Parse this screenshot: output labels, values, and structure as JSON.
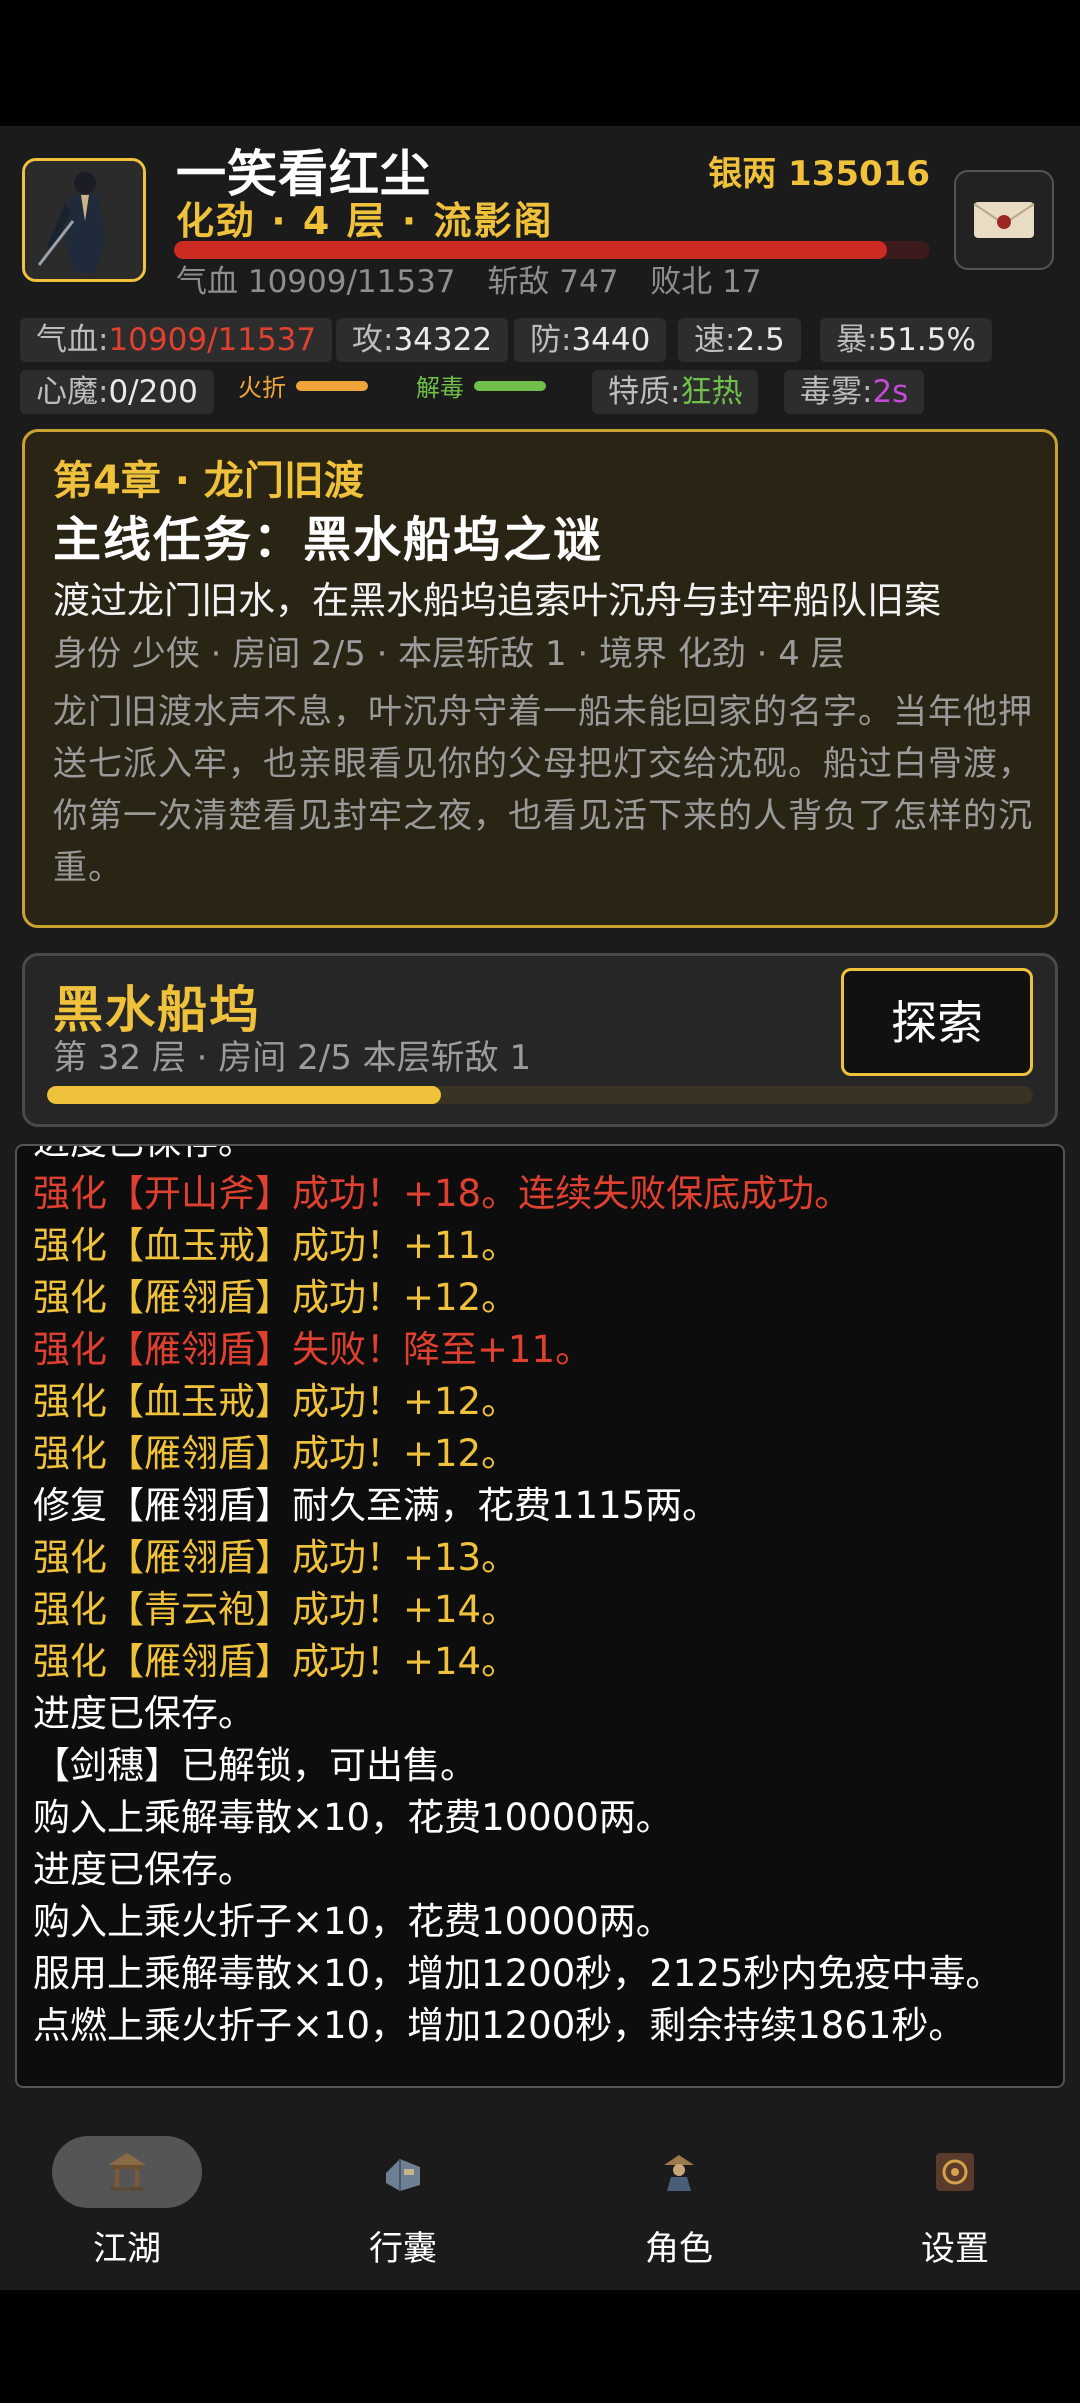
{
  "header": {
    "name": "一笑看红尘",
    "silver": "银两 135016",
    "realm": "化劲 · 4 层 · 流影阁",
    "hp_fraction": 0.943,
    "stats": {
      "hp": "气血 10909/11537",
      "kills": "斩敌 747",
      "defeats": "败北 17"
    }
  },
  "attrs": {
    "hp_label": "气血:",
    "hp_value": "10909/11537",
    "atk_label": "攻:",
    "atk_value": "34322",
    "def_label": "防:",
    "def_value": "3440",
    "spd_label": "速:",
    "spd_value": "2.5",
    "crit_label": "暴:",
    "crit_value": "51.5%",
    "demon_label": "心魔:",
    "demon_value": "0/200",
    "buff_fire": "火折",
    "buff_antidote": "解毒",
    "trait_label": "特质:",
    "trait_value": "狂热",
    "poison_label": "毒雾:",
    "poison_value": "2s"
  },
  "quest": {
    "chapter": "第4章 · 龙门旧渡",
    "title": "主线任务：黑水船坞之谜",
    "goal": "渡过龙门旧水，在黑水船坞追索叶沉舟与封牢船队旧案",
    "meta": "身份 少侠 · 房间 2/5 · 本层斩敌 1 · 境界 化劲 · 4 层",
    "story": "龙门旧渡水声不息，叶沉舟守着一船未能回家的名字。当年他押送七派入牢，也亲眼看见你的父母把灯交给沈砚。船过白骨渡，你第一次清楚看见封牢之夜，也看见活下来的人背负了怎样的沉重。"
  },
  "location": {
    "name": "黑水船坞",
    "info": "第 32 层 · 房间 2/5   本层斩敌 1",
    "explore": "探索",
    "progress_fraction": 0.4
  },
  "log": [
    {
      "text": "进度已保存。",
      "color": "white"
    },
    {
      "text": "强化【开山斧】成功！+18。连续失败保底成功。",
      "color": "red"
    },
    {
      "text": "强化【血玉戒】成功！+11。",
      "color": "gold"
    },
    {
      "text": "强化【雁翎盾】成功！+12。",
      "color": "gold"
    },
    {
      "text": "强化【雁翎盾】失败！降至+11。",
      "color": "red"
    },
    {
      "text": "强化【血玉戒】成功！+12。",
      "color": "gold"
    },
    {
      "text": "强化【雁翎盾】成功！+12。",
      "color": "gold"
    },
    {
      "text": "修复【雁翎盾】耐久至满，花费1115两。",
      "color": "white"
    },
    {
      "text": "强化【雁翎盾】成功！+13。",
      "color": "gold"
    },
    {
      "text": "强化【青云袍】成功！+14。",
      "color": "gold"
    },
    {
      "text": "强化【雁翎盾】成功！+14。",
      "color": "gold"
    },
    {
      "text": "进度已保存。",
      "color": "white"
    },
    {
      "text": "【剑穗】已解锁，可出售。",
      "color": "white"
    },
    {
      "text": "购入上乘解毒散×10，花费10000两。",
      "color": "white"
    },
    {
      "text": "进度已保存。",
      "color": "white"
    },
    {
      "text": "购入上乘火折子×10，花费10000两。",
      "color": "white"
    },
    {
      "text": "服用上乘解毒散×10，增加1200秒，2125秒内免疫中毒。",
      "color": "white"
    },
    {
      "text": "点燃上乘火折子×10，增加1200秒，剩余持续1861秒。",
      "color": "white"
    }
  ],
  "nav": [
    {
      "label": "江湖",
      "icon": "pavilion-icon",
      "active": true
    },
    {
      "label": "行囊",
      "icon": "bag-icon",
      "active": false
    },
    {
      "label": "角色",
      "icon": "hero-icon",
      "active": false
    },
    {
      "label": "设置",
      "icon": "settings-icon",
      "active": false
    }
  ],
  "colors": {
    "gold": "#f0c23b",
    "red": "#e0402f",
    "green": "#6fbf4a",
    "purple": "#c24bd4"
  }
}
